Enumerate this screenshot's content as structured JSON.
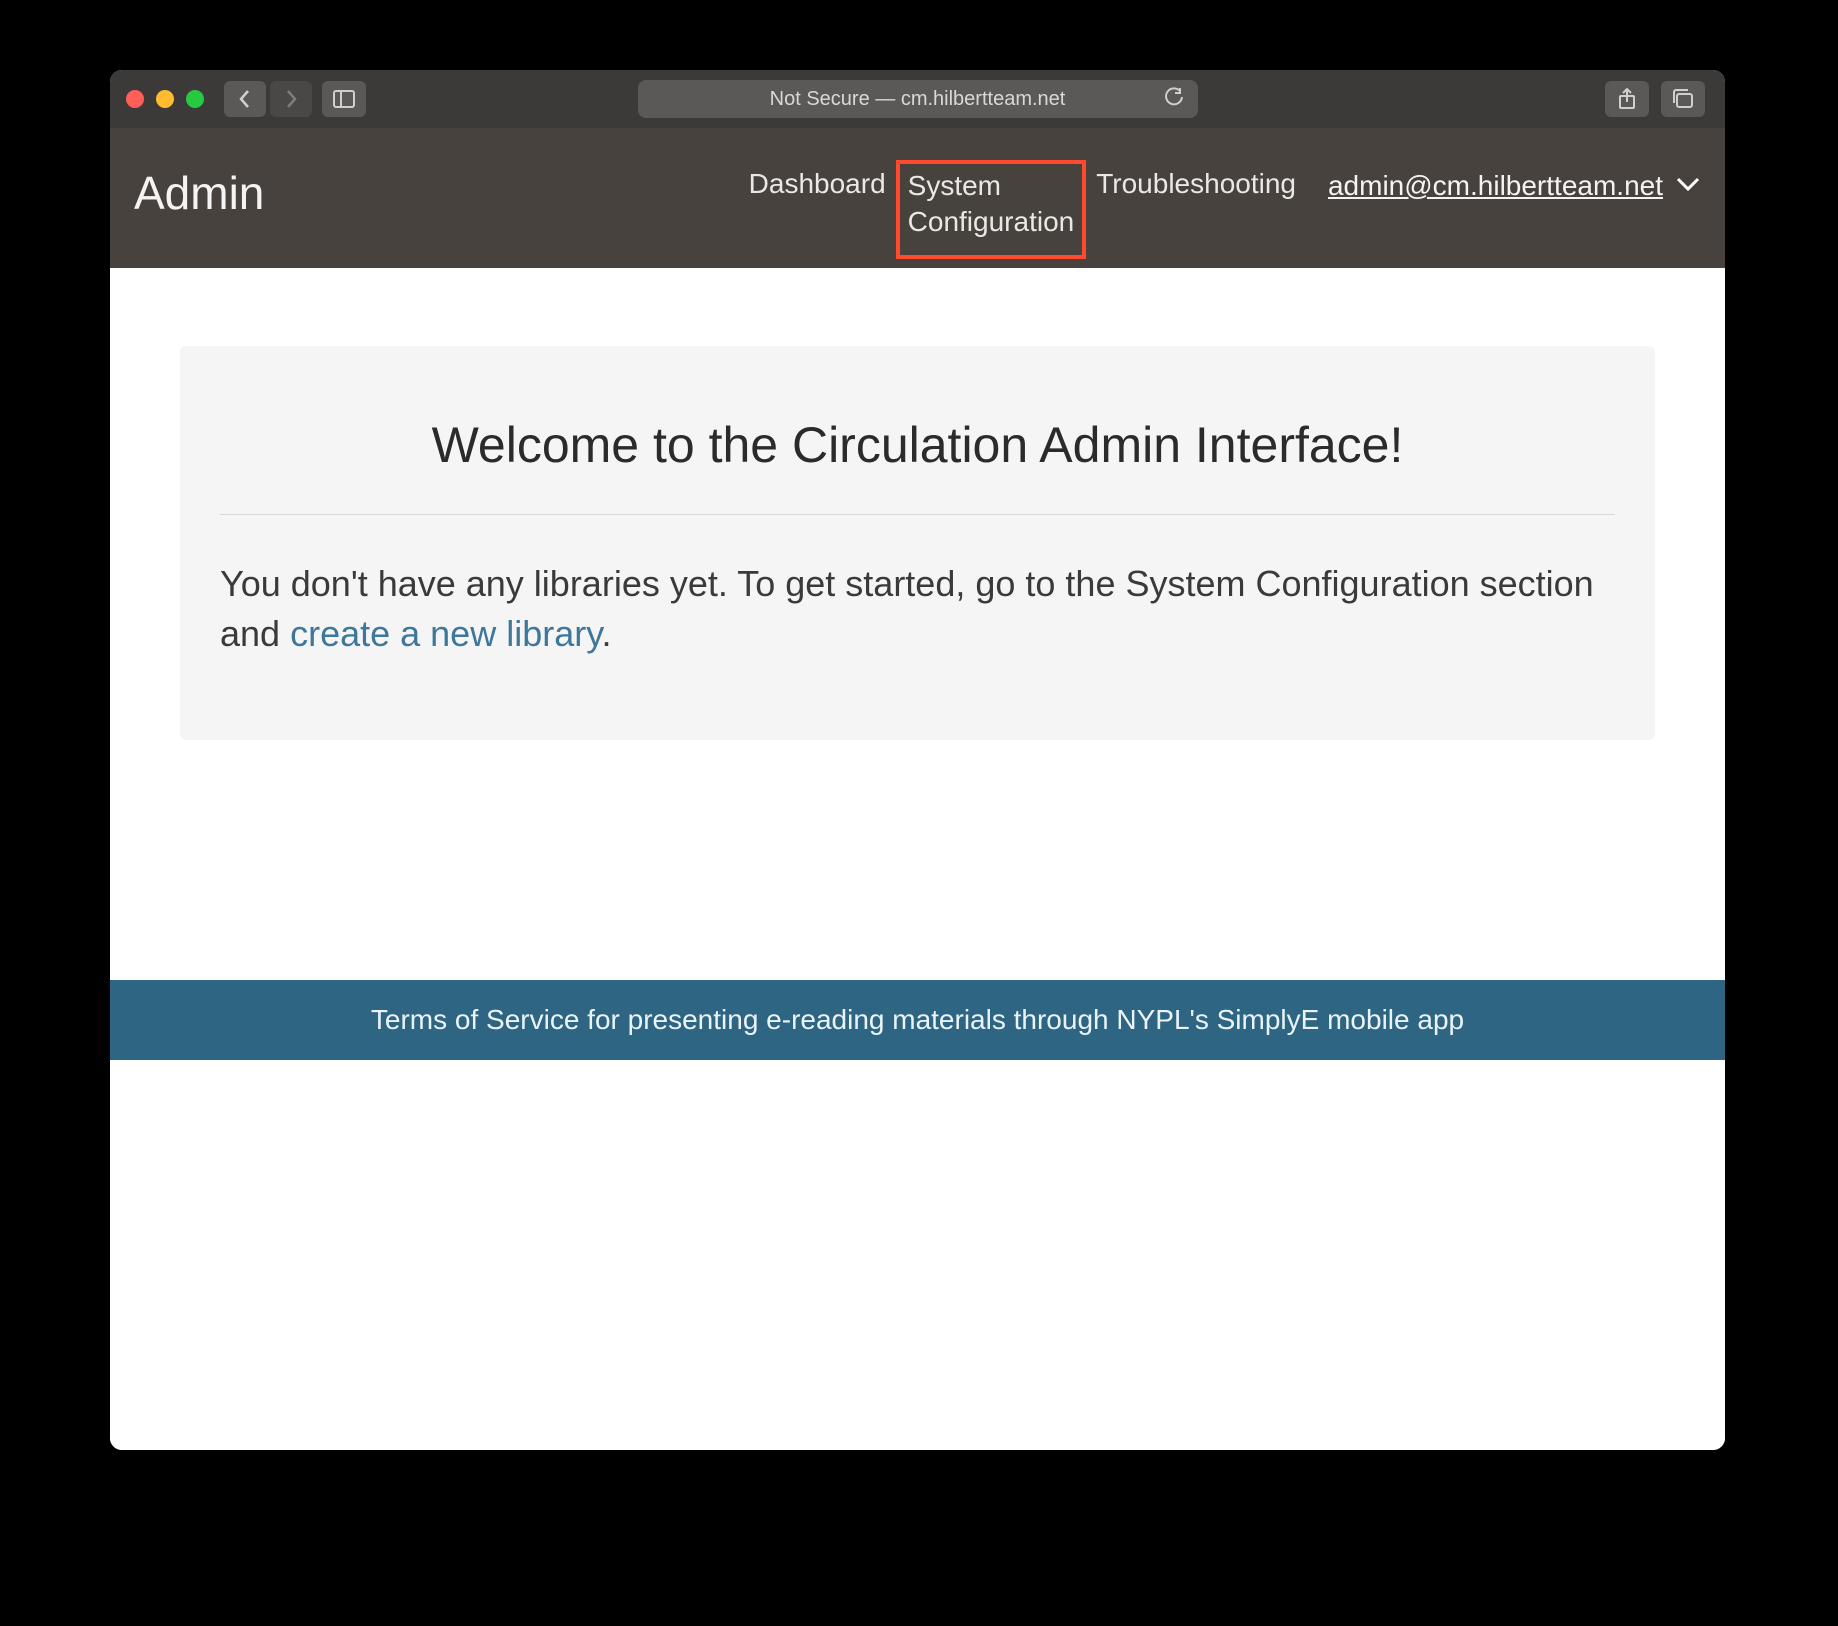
{
  "browser": {
    "security_label": "Not Secure — ",
    "address": "cm.hilbertteam.net"
  },
  "header": {
    "brand": "Admin",
    "nav": {
      "dashboard": "Dashboard",
      "system_config_line1": "System",
      "system_config_line2": "Configuration",
      "troubleshooting": "Troubleshooting"
    },
    "user": "admin@cm.hilbertteam.net"
  },
  "main": {
    "welcome_title": "Welcome to the Circulation Admin Interface!",
    "body_prefix": "You don't have any libraries yet. To get started, go to the System Configuration section and ",
    "body_link": "create a new library",
    "body_suffix": "."
  },
  "footer": {
    "text": "Terms of Service for presenting e-reading materials through NYPL's SimplyE mobile app"
  }
}
